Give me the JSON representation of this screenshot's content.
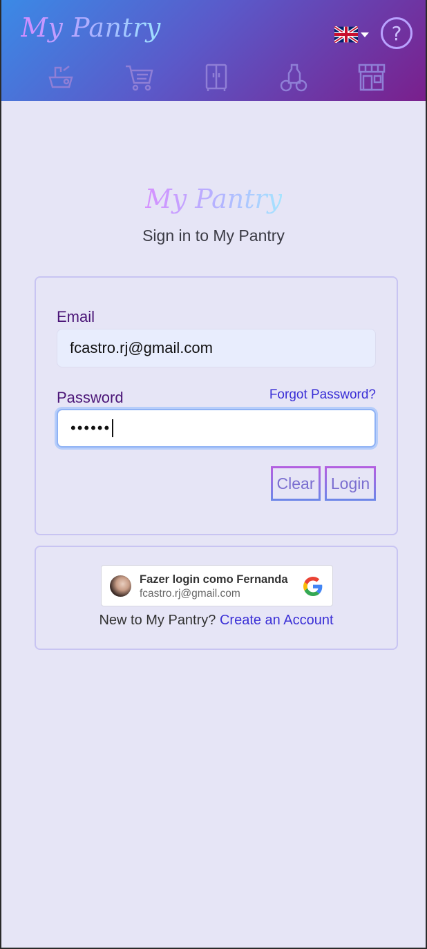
{
  "header": {
    "brand": "My Pantry",
    "language_icon": "uk-flag-icon",
    "help_icon": "help-question-icon",
    "help_glyph": "?",
    "nav_icons": [
      "kitchen-sink-icon",
      "shopping-cart-icon",
      "cupboard-icon",
      "groceries-icon",
      "store-icon"
    ]
  },
  "main": {
    "logo": "My Pantry",
    "subtitle": "Sign in to My Pantry"
  },
  "login_form": {
    "email_label": "Email",
    "email_value": "fcastro.rj@gmail.com",
    "password_label": "Password",
    "password_value": "••••••",
    "forgot_link": "Forgot Password?",
    "clear_button": "Clear",
    "login_button": "Login"
  },
  "google_signin": {
    "title": "Fazer login como Fernanda",
    "email": "fcastro.rj@gmail.com",
    "icon": "google-g-icon"
  },
  "signup": {
    "prompt": "New to My Pantry?",
    "link": "Create an Account"
  },
  "colors": {
    "header_gradient_start": "#3b8ae6",
    "header_gradient_end": "#7a1f8c",
    "page_background": "#e6e5f6",
    "label_color": "#4b1577",
    "link_color": "#3a2fd6"
  }
}
